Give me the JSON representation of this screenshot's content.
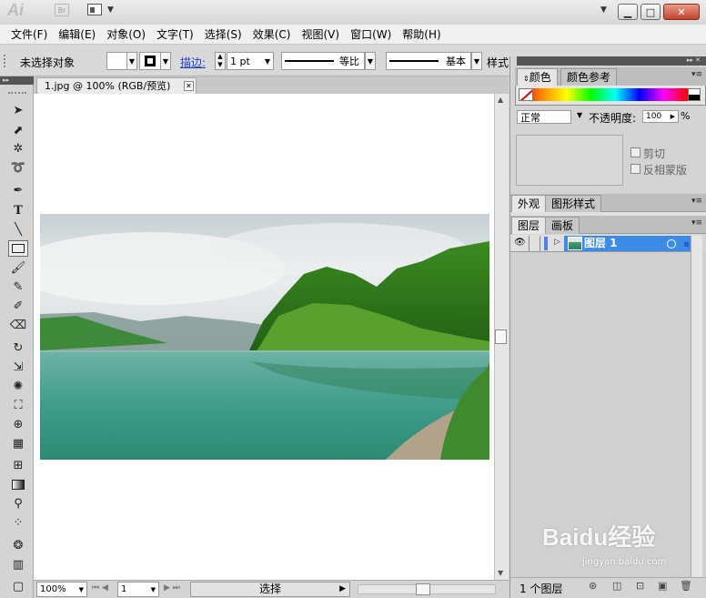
{
  "app": {
    "logo": "Ai",
    "bridge_label": "Br"
  },
  "menu": [
    "文件(F)",
    "编辑(E)",
    "对象(O)",
    "文字(T)",
    "选择(S)",
    "效果(C)",
    "视图(V)",
    "窗口(W)",
    "帮助(H)"
  ],
  "control": {
    "selection_label": "未选择对象",
    "stroke_label": "描边:",
    "stroke_weight": "1 pt",
    "profile_label": "等比",
    "brush_label": "基本",
    "style_label": "样式:"
  },
  "document": {
    "tab_title": "1.jpg @ 100% (RGB/预览)"
  },
  "status": {
    "zoom": "100%",
    "artboard": "1",
    "tool": "选择"
  },
  "color_panel": {
    "tabs": [
      "颜色",
      "颜色参考"
    ],
    "active_tab": "颜色"
  },
  "transparency": {
    "mode": "正常",
    "opacity_label": "不透明度:",
    "opacity": "100",
    "opacity_unit": "%",
    "clip_label": "剪切",
    "invert_label": "反相蒙版"
  },
  "appearance": {
    "tabs": [
      "外观",
      "图形样式"
    ]
  },
  "layers": {
    "tabs": [
      "图层",
      "画板"
    ],
    "items": [
      {
        "name": "图层 1",
        "visible": true
      }
    ],
    "count": "1 个图层"
  },
  "watermark": {
    "main": "Baidu经验",
    "sub": "jingyan.baidu.com"
  }
}
